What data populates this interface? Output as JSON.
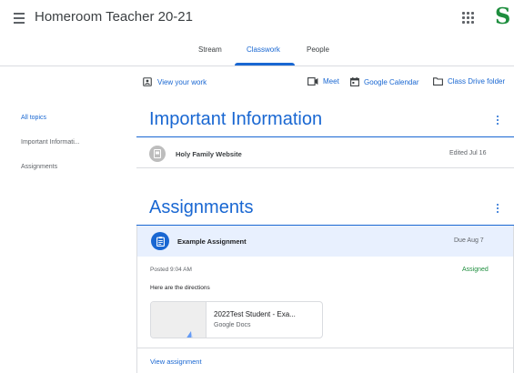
{
  "header": {
    "title": "Homeroom Teacher 20-21",
    "account_initial": "S"
  },
  "tabs": [
    {
      "label": "Stream"
    },
    {
      "label": "Classwork",
      "active": true
    },
    {
      "label": "People"
    }
  ],
  "actions": {
    "view_your_work": "View your work",
    "meet": "Meet",
    "calendar": "Google Calendar",
    "drive": "Class Drive folder"
  },
  "sidebar": {
    "items": [
      {
        "label": "All topics",
        "active": true
      },
      {
        "label": "Important Informati..."
      },
      {
        "label": "Assignments"
      }
    ]
  },
  "sections": {
    "info": {
      "title": "Important Information",
      "material": {
        "title": "Holy Family Website",
        "meta": "Edited Jul 16"
      }
    },
    "assignments": {
      "title": "Assignments",
      "assignment": {
        "title": "Example Assignment",
        "due": "Due Aug 7",
        "posted": "Posted 9:04 AM",
        "status": "Assigned",
        "directions": "Here are the directions",
        "attachment_title": "2022Test Student - Exa...",
        "attachment_type": "Google Docs",
        "view_link": "View assignment"
      }
    }
  },
  "icons": {
    "menu": "menu-icon",
    "apps": "apps-grid-icon",
    "view_work": "id-card-icon",
    "meet": "video-camera-icon",
    "calendar": "calendar-icon",
    "drive": "folder-icon",
    "more": "more-vert-icon",
    "material": "document-icon",
    "assignment": "assignment-icon"
  },
  "colors": {
    "accent": "#1967d2",
    "assigned_status": "#1e8e3e",
    "account_badge": "#1e8e3e",
    "assignment_header_bg": "#e8f0fe"
  }
}
